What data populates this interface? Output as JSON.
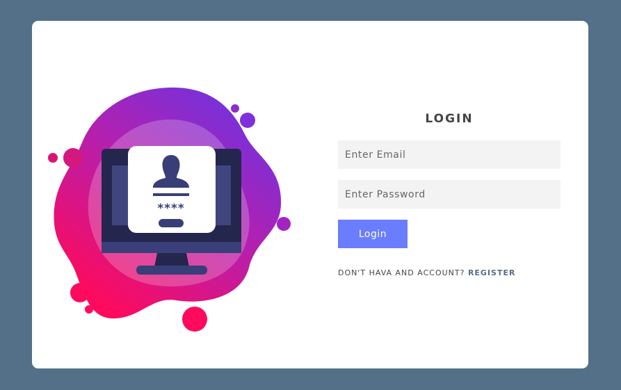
{
  "form": {
    "title": "LOGIN",
    "email_placeholder": "Enter Email",
    "password_placeholder": "Enter Password",
    "login_label": "Login",
    "register_prompt": "DON'T HAVA AND ACCOUNT? ",
    "register_label": "REGISTER"
  },
  "illustration": {
    "password_mask": "****",
    "icon": "monitor-user-login-icon"
  },
  "colors": {
    "page_background": "#537088",
    "card_background": "#ffffff",
    "button": "#6a7dfe",
    "input_background": "#f3f3f3",
    "register_link": "#537088",
    "blob_pink": "#ff0a5c",
    "blob_purple": "#7b2fe0",
    "monitor_dark": "#24264e"
  }
}
